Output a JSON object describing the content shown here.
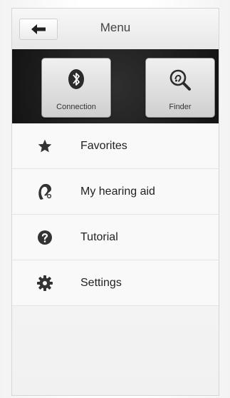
{
  "header": {
    "title": "Menu"
  },
  "tiles": [
    {
      "label": "Connection",
      "icon": "bluetooth-icon"
    },
    {
      "label": "Finder",
      "icon": "finder-icon"
    }
  ],
  "menu": [
    {
      "label": "Favorites",
      "icon": "star-icon"
    },
    {
      "label": "My hearing aid",
      "icon": "hearing-aid-icon"
    },
    {
      "label": "Tutorial",
      "icon": "help-icon"
    },
    {
      "label": "Settings",
      "icon": "gear-icon"
    }
  ],
  "colors": {
    "dark_panel": "#1c1c1c",
    "icon": "#333333"
  }
}
